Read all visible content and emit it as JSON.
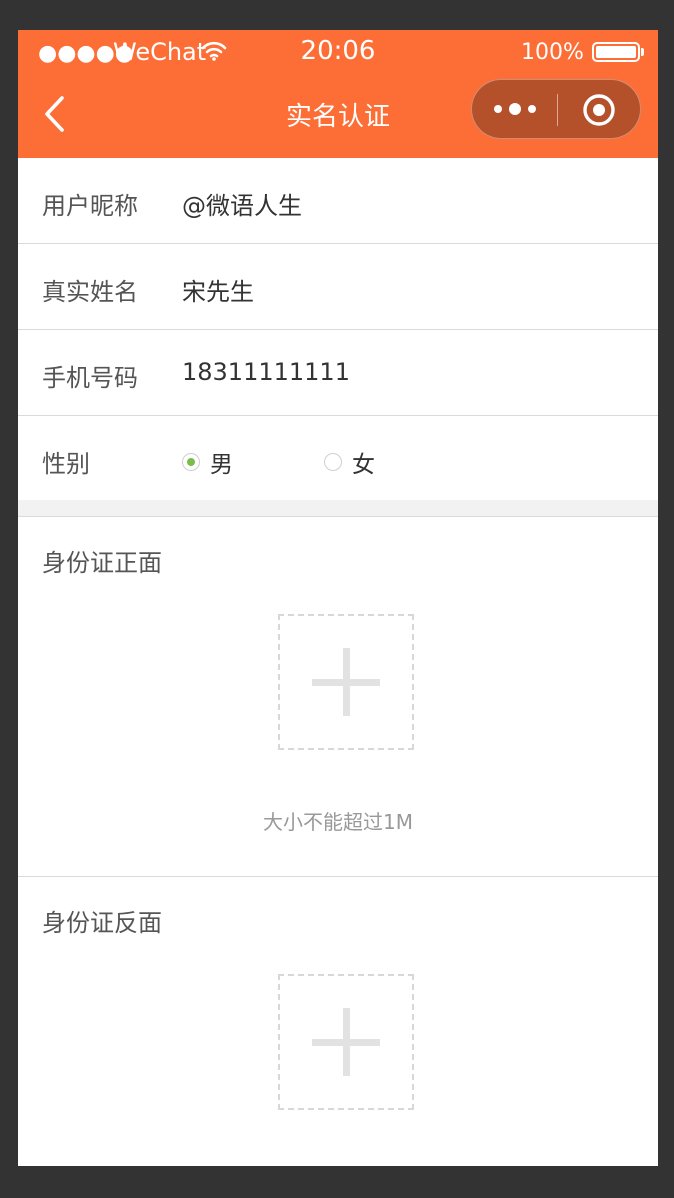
{
  "status_bar": {
    "signal": "●●●●●",
    "carrier": "WeChat",
    "time": "20:06",
    "battery": "100%"
  },
  "nav": {
    "title": "实名认证",
    "back_icon": "chevron-left-icon",
    "more_icon": "more-dots-icon",
    "close_icon": "target-close-icon"
  },
  "form": {
    "nickname": {
      "label": "用户昵称",
      "value": "@微语人生"
    },
    "real_name": {
      "label": "真实姓名",
      "value": "宋先生"
    },
    "phone": {
      "label": "手机号码",
      "value": "18311111111"
    },
    "gender": {
      "label": "性别",
      "options": [
        "男",
        "女"
      ],
      "selected": "男"
    }
  },
  "id_front": {
    "title": "身份证正面",
    "hint": "大小不能超过1M"
  },
  "id_back": {
    "title": "身份证反面"
  },
  "colors": {
    "header": "#FD6E37",
    "capsule": "#B4502A",
    "radio_selected": "#7BBD4A",
    "background": "#333333"
  }
}
